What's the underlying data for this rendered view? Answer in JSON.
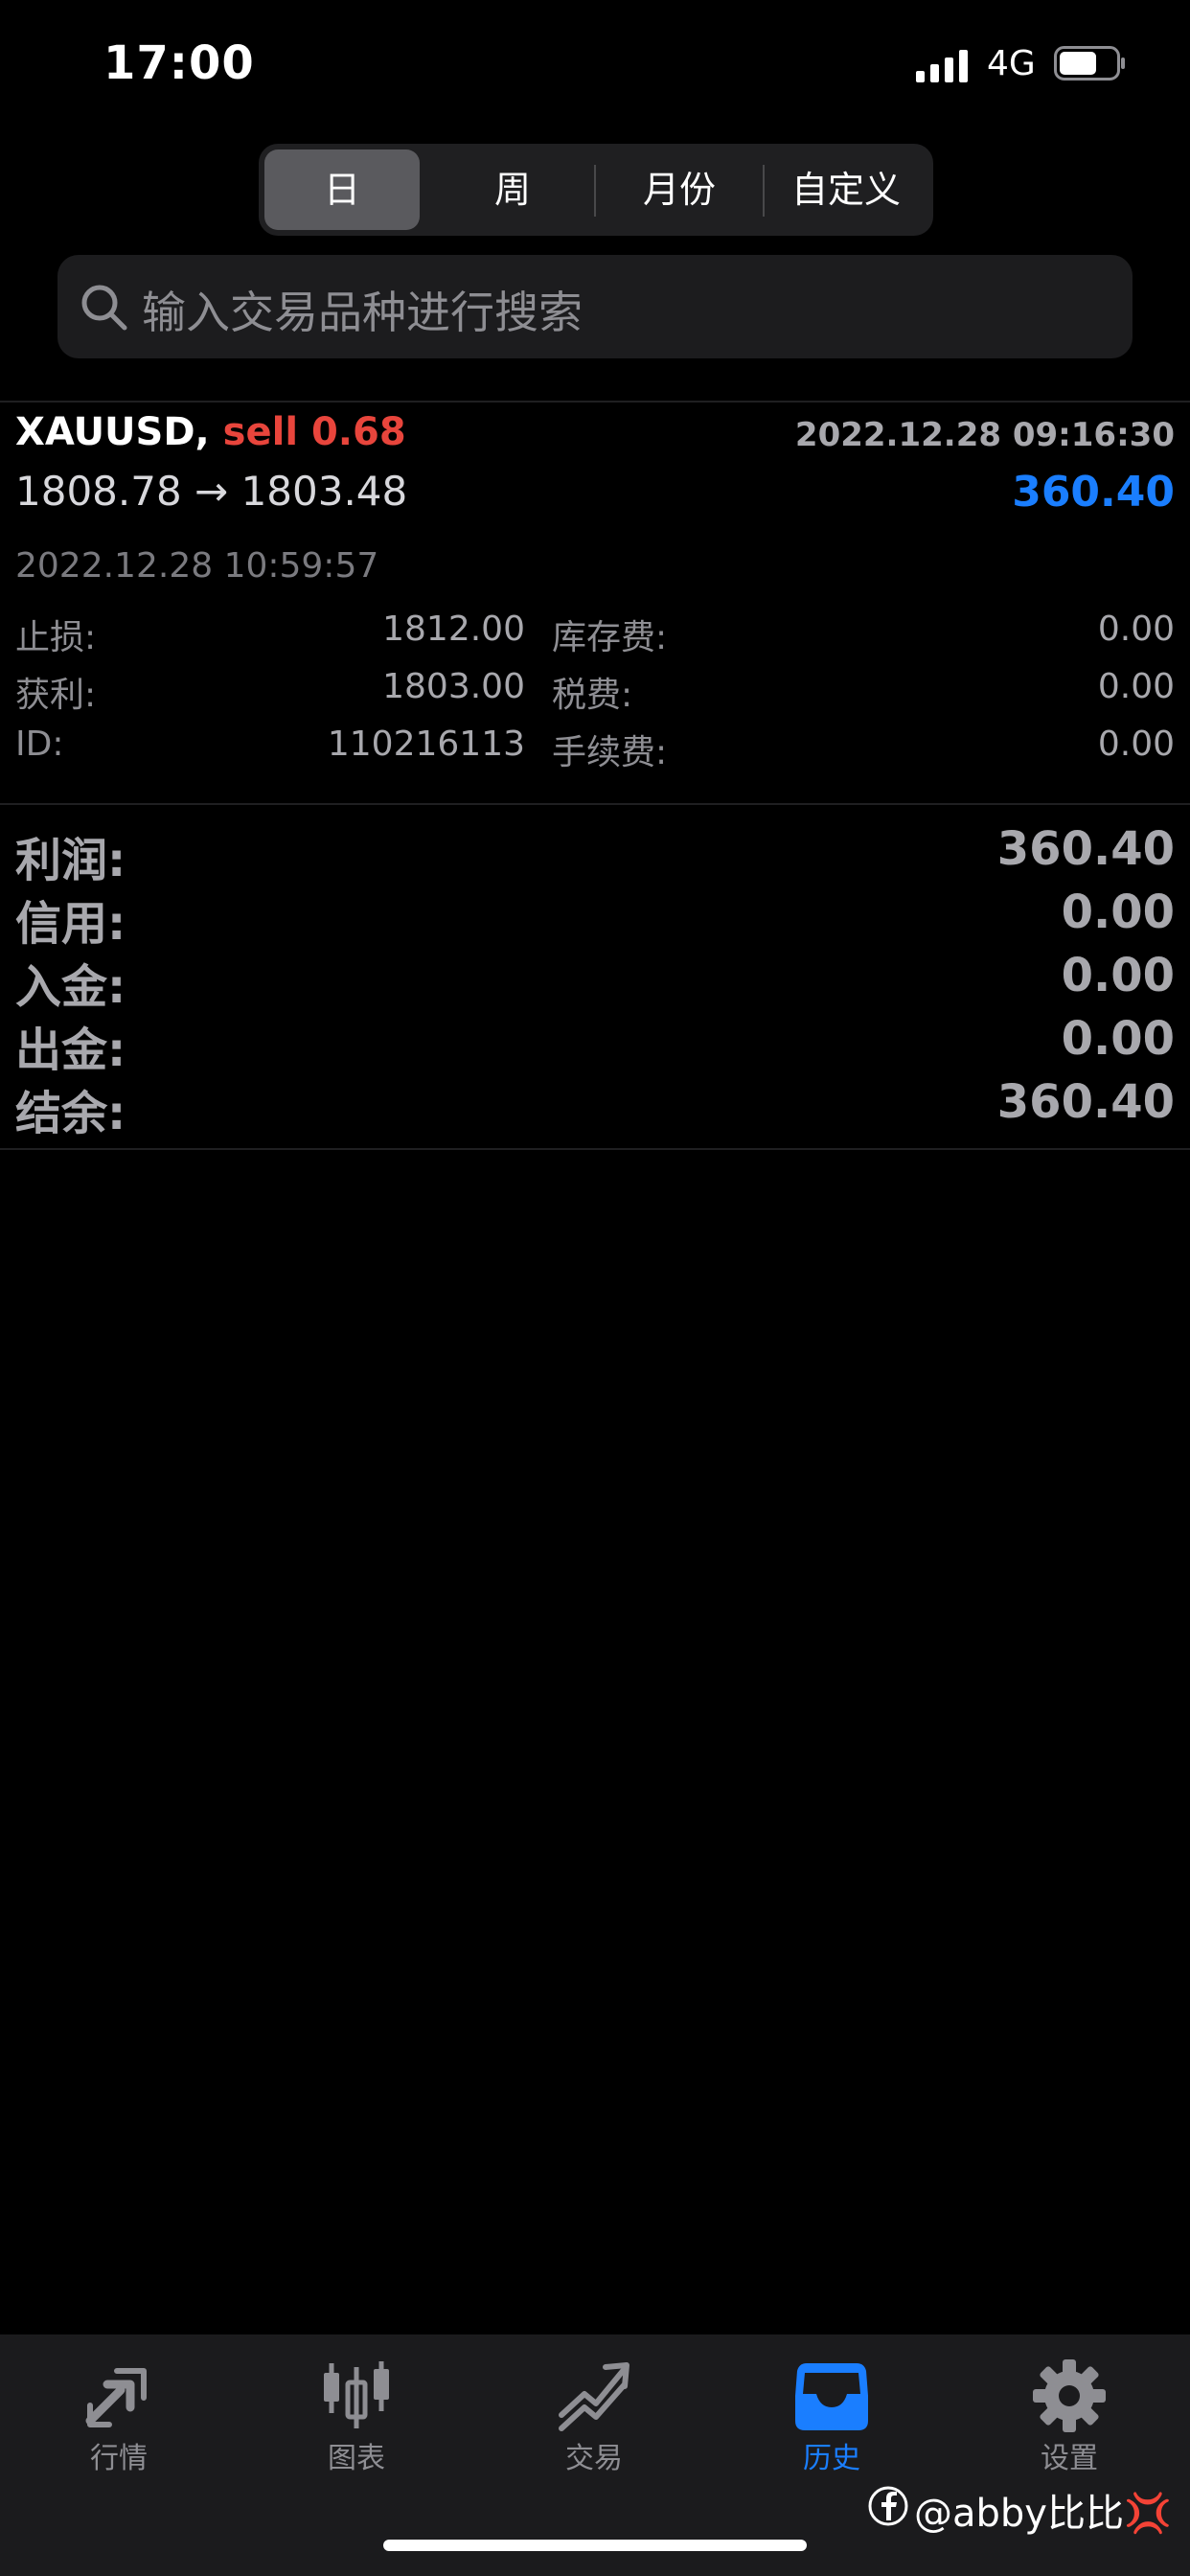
{
  "status_bar": {
    "time": "17:00",
    "network": "4G"
  },
  "segments": {
    "items": [
      "日",
      "周",
      "月份",
      "自定义"
    ],
    "selected": 0
  },
  "search": {
    "placeholder": "输入交易品种进行搜索"
  },
  "trade": {
    "symbol": "XAUUSD,",
    "side": "sell 0.68",
    "open_time": "2022.12.28 09:16:30",
    "prices": "1808.78 → 1803.48",
    "profit": "360.40",
    "close_time": "2022.12.28 10:59:57",
    "details": [
      {
        "label": "止损:",
        "value": "1812.00",
        "label2": "库存费:",
        "value2": "0.00"
      },
      {
        "label": "获利:",
        "value": "1803.00",
        "label2": "税费:",
        "value2": "0.00"
      },
      {
        "label": "ID:",
        "value": "110216113",
        "label2": "手续费:",
        "value2": "0.00"
      }
    ]
  },
  "summary": [
    {
      "label": "利润:",
      "value": "360.40"
    },
    {
      "label": "信用:",
      "value": "0.00"
    },
    {
      "label": "入金:",
      "value": "0.00"
    },
    {
      "label": "出金:",
      "value": "0.00"
    },
    {
      "label": "结余:",
      "value": "360.40"
    }
  ],
  "tabbar": {
    "items": [
      {
        "label": "行情",
        "icon": "quotes-arrows-icon"
      },
      {
        "label": "图表",
        "icon": "candlestick-icon"
      },
      {
        "label": "交易",
        "icon": "trade-trend-icon"
      },
      {
        "label": "历史",
        "icon": "inbox-icon"
      },
      {
        "label": "设置",
        "icon": "gear-icon"
      }
    ],
    "active": 3
  },
  "watermark": "@abby比比💢",
  "colors": {
    "accent_blue": "#1a7eff",
    "sell_red": "#e8453c",
    "background": "#000000"
  }
}
